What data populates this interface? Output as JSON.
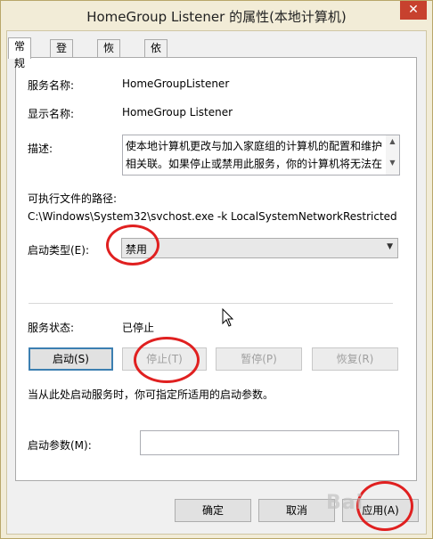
{
  "window": {
    "title": "HomeGroup Listener 的属性(本地计算机)",
    "close_glyph": "✕"
  },
  "tabs": [
    {
      "label": "常规"
    },
    {
      "label": "登录"
    },
    {
      "label": "恢复"
    },
    {
      "label": "依存关系"
    }
  ],
  "general": {
    "service_name_label": "服务名称:",
    "service_name_value": "HomeGroupListener",
    "display_name_label": "显示名称:",
    "display_name_value": "HomeGroup Listener",
    "description_label": "描述:",
    "description_line1": "使本地计算机更改与加入家庭组的计算机的配置和维护",
    "description_line2": "相关联。如果停止或禁用此服务，你的计算机将无法在",
    "exe_path_label": "可执行文件的路径:",
    "exe_path_value": "C:\\Windows\\System32\\svchost.exe -k LocalSystemNetworkRestricted",
    "startup_type_label": "启动类型(E):",
    "startup_type_value": "禁用",
    "service_status_label": "服务状态:",
    "service_status_value": "已停止",
    "start_button": "启动(S)",
    "stop_button": "停止(T)",
    "pause_button": "暂停(P)",
    "resume_button": "恢复(R)",
    "hint_text": "当从此处启动服务时，你可指定所适用的启动参数。",
    "start_params_label": "启动参数(M):",
    "start_params_value": ""
  },
  "footer": {
    "ok_button": "确定",
    "cancel_button": "取消",
    "apply_button": "应用(A)"
  },
  "watermark": "Bai",
  "colors": {
    "annotation": "#e02020",
    "title_bar": "#f2ecd7",
    "close_button": "#c7412e"
  }
}
